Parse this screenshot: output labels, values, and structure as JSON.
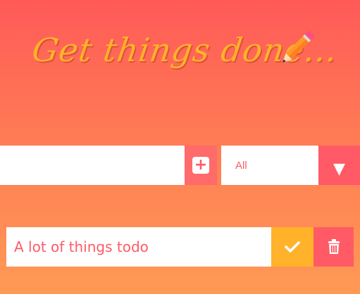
{
  "header": {
    "title": "Get things done..."
  },
  "form": {
    "input_value": "",
    "add_button_icon": "plus-square-icon",
    "filter_selected": "All",
    "filter_arrow": "▼"
  },
  "todos": [
    {
      "text": "A lot of things todo"
    }
  ],
  "colors": {
    "accent_red": "#ff5a66",
    "accent_yellow": "#ffb22a"
  }
}
